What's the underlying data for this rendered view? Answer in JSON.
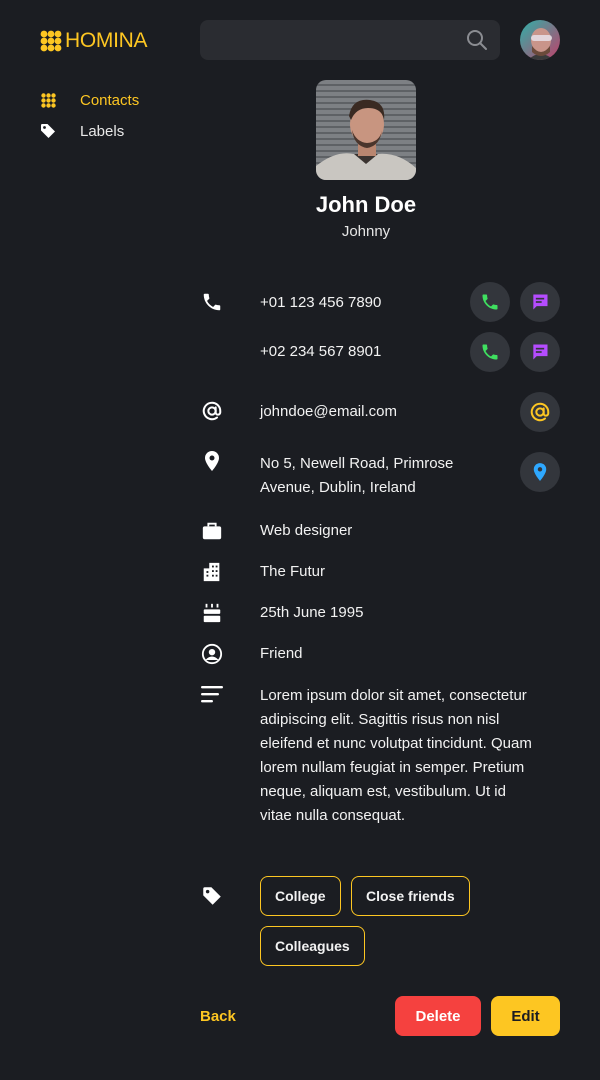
{
  "app": {
    "name": "HOMINA"
  },
  "colors": {
    "accent": "#fdc622",
    "background": "#1b1d22",
    "call": "#3fe060",
    "message": "#b54cff",
    "location": "#2ea8ff",
    "danger": "#f5413f"
  },
  "sidebar": {
    "items": [
      {
        "label": "Contacts",
        "icon": "grid-icon",
        "active": true
      },
      {
        "label": "Labels",
        "icon": "tag-icon",
        "active": false
      }
    ]
  },
  "search": {
    "value": "",
    "placeholder": ""
  },
  "contact": {
    "name": "John Doe",
    "nickname": "Johnny",
    "phones": [
      "+01 123 456 7890",
      "+02 234 567 8901"
    ],
    "email": "johndoe@email.com",
    "address_line1": "No 5, Newell Road, Primrose",
    "address_line2": "Avenue, Dublin, Ireland",
    "job_title": "Web designer",
    "company": "The Futur",
    "birthday": "25th June 1995",
    "relationship": "Friend",
    "notes": [
      "Lorem ipsum dolor sit amet, consectetur",
      "adipiscing elit. Sagittis risus non nisl",
      "eleifend et nunc volutpat tincidunt. Quam",
      "lorem nullam feugiat in semper. Pretium",
      "neque, aliquam est, vestibulum. Ut id",
      "vitae nulla consequat."
    ],
    "labels": [
      "College",
      "Close friends",
      "Colleagues"
    ]
  },
  "actions": {
    "back": "Back",
    "delete": "Delete",
    "edit": "Edit"
  }
}
